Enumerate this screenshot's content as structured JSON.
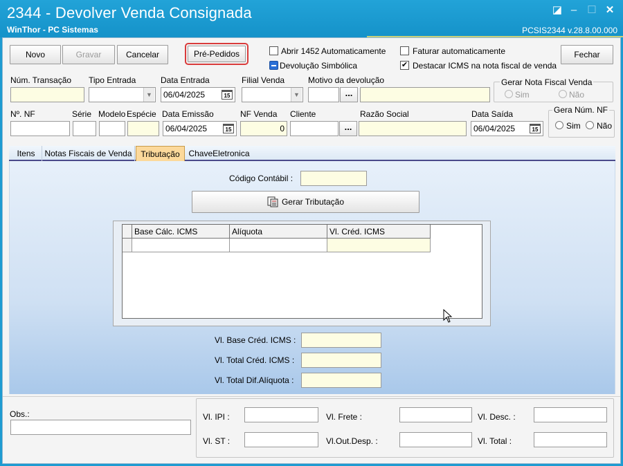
{
  "window": {
    "title": "2344 - Devolver Venda Consignada",
    "subtitle": "WinThor - PC Sistemas",
    "version": "PCSIS2344  v.28.8.00.000",
    "controls": {
      "restore": "◪",
      "minimize": "–",
      "maximize": "☐",
      "close": "✕"
    }
  },
  "toolbar": {
    "novo": "Novo",
    "gravar": "Gravar",
    "cancelar": "Cancelar",
    "pre_pedidos": "Pré-Pedidos",
    "fechar": "Fechar"
  },
  "options": {
    "abrir_1452": {
      "label": "Abrir 1452 Automaticamente",
      "checked": false
    },
    "devolucao_simbolica": {
      "label": "Devolução Simbólica",
      "checked": "indeterminate"
    },
    "faturar_auto": {
      "label": "Faturar automaticamente",
      "checked": false
    },
    "destacar_icms": {
      "label": "Destacar ICMS na nota fiscal de venda",
      "checked": true,
      "mark": "✔"
    }
  },
  "row1": {
    "num_transacao": {
      "label": "Núm. Transação",
      "value": ""
    },
    "tipo_entrada": {
      "label": "Tipo Entrada",
      "value": ""
    },
    "data_entrada": {
      "label": "Data Entrada",
      "value": "06/04/2025"
    },
    "filial_venda": {
      "label": "Filial Venda",
      "value": ""
    },
    "motivo_devolucao": {
      "label": "Motivo da devolução",
      "code": "",
      "desc": ""
    },
    "gerar_nf_venda": {
      "title": "Gerar Nota Fiscal Venda",
      "sim": "Sim",
      "nao": "Não"
    }
  },
  "row2": {
    "num_nf": {
      "label": "Nº. NF",
      "value": ""
    },
    "serie": {
      "label": "Série",
      "value": ""
    },
    "modelo": {
      "label": "Modelo",
      "value": ""
    },
    "especie": {
      "label": "Espécie",
      "value": ""
    },
    "data_emissao": {
      "label": "Data Emissão",
      "value": "06/04/2025"
    },
    "nf_venda": {
      "label": "NF Venda",
      "value": "0"
    },
    "cliente": {
      "label": "Cliente",
      "value": ""
    },
    "razao_social": {
      "label": "Razão Social",
      "value": ""
    },
    "data_saida": {
      "label": "Data Saída",
      "value": "06/04/2025"
    },
    "gera_num_nf": {
      "title": "Gera Núm. NF",
      "sim": "Sim",
      "nao": "Não"
    }
  },
  "ellipsis": "...",
  "calendar_icon_text": "15",
  "tabs": [
    {
      "label": "Itens",
      "active": false
    },
    {
      "label": "Notas Fiscais de Venda",
      "active": false
    },
    {
      "label": "Tributação",
      "active": true
    },
    {
      "label": "ChaveEletronica",
      "active": false
    }
  ],
  "tributacao": {
    "codigo_contabil": {
      "label": "Código Contábil :",
      "value": ""
    },
    "gerar_btn": "Gerar Tributação",
    "grid": {
      "columns": [
        "Base Cálc. ICMS",
        "Alíquota",
        "Vl. Créd. ICMS"
      ],
      "rows": [
        [
          "",
          "",
          ""
        ]
      ]
    },
    "vl_base_cred": {
      "label": "Vl. Base Créd. ICMS :",
      "value": ""
    },
    "vl_total_cred": {
      "label": "Vl. Total Créd. ICMS :",
      "value": ""
    },
    "vl_total_dif": {
      "label": "Vl. Total Dif.Alíquota :",
      "value": ""
    }
  },
  "footer": {
    "obs": {
      "label": "Obs.:",
      "value": ""
    },
    "vl_ipi": {
      "label": "Vl. IPI :",
      "value": ""
    },
    "vl_st": {
      "label": "Vl. ST :",
      "value": ""
    },
    "vl_frete": {
      "label": "Vl. Frete :",
      "value": ""
    },
    "vl_out_desp": {
      "label": "Vl.Out.Desp. :",
      "value": ""
    },
    "vl_desc": {
      "label": "Vl. Desc. :",
      "value": ""
    },
    "vl_total": {
      "label": "Vl. Total  :",
      "value": ""
    }
  }
}
